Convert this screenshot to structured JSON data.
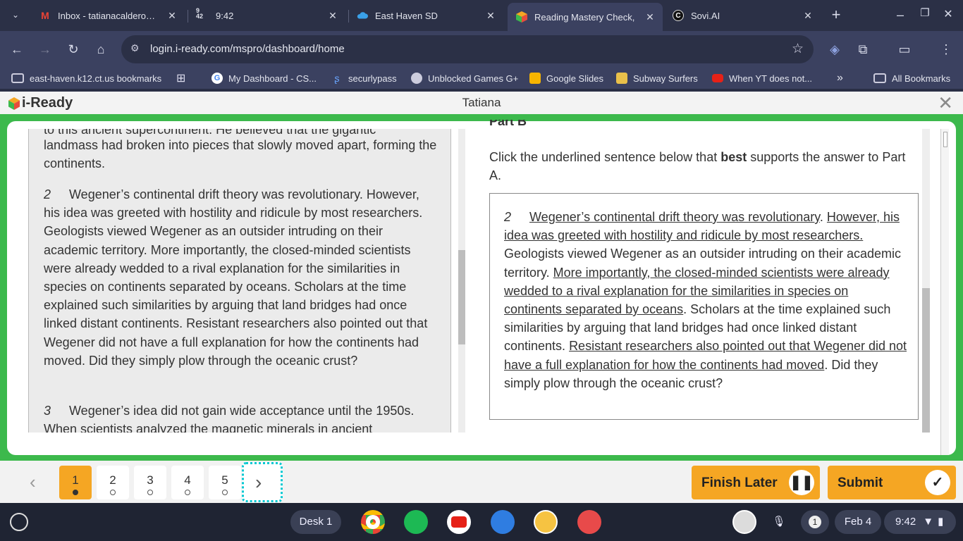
{
  "tabs": [
    {
      "title": "Inbox - tatianacalderon@"
    },
    {
      "title": "9:42",
      "fav_top": "9",
      "fav_bottom": "42"
    },
    {
      "title": "East Haven SD"
    },
    {
      "title": "Reading Mastery Check, "
    },
    {
      "title": "Sovi.AI"
    }
  ],
  "url": "login.i-ready.com/mspro/dashboard/home",
  "bookmarks": {
    "items": [
      "east-haven.k12.ct.us bookmarks",
      "My Dashboard - CS...",
      "securlypass",
      "Unblocked Games G+",
      "Google Slides",
      "Subway Surfers",
      "When YT does not..."
    ],
    "all": "All Bookmarks"
  },
  "header": {
    "logo": "i-Ready",
    "student": "Tatiana"
  },
  "passage": {
    "top_clip": "to this ancient supercontinent. He believed that the gigantic",
    "p1_rest": "landmass had broken into pieces that slowly moved apart, forming the continents.",
    "p2_num": "2",
    "p2": "Wegener’s continental drift theory was revolutionary. However, his idea was greeted with hostility and ridicule by most researchers. Geologists viewed Wegener as an outsider intruding on their academic territory. More importantly, the closed-minded scientists were already wedded to a rival explanation for the similarities in species on continents separated by oceans. Scholars at the time explained such similarities by arguing that land bridges had once linked distant continents. Resistant researchers also pointed out that Wegener did not have a full explanation for how the continents had moved. Did they simply plow through the oceanic crust?",
    "p3_num": "3",
    "p3": "Wegener’s idea did not gain wide acceptance until the 1950s. When scientists analyzed the magnetic minerals in ancient"
  },
  "question": {
    "part_label": "Part B",
    "prompt_pre": "Click the underlined sentence below that ",
    "prompt_bold": "best",
    "prompt_post": " supports the answer to Part A.",
    "para_num": "2",
    "s1": "Wegener’s continental drift theory was revolutionary",
    "s1_end": ". ",
    "s2": "However, his idea was greeted with hostility and ridicule by most researchers.",
    "s3": " Geologists viewed Wegener as an outsider intruding on their academic territory. ",
    "s4": "More importantly, the closed-minded scientists were already wedded to a rival explanation for the similarities in species on continents separated by oceans",
    "s5": ". Scholars at the time explained such similarities by arguing that land bridges had once linked distant continents. ",
    "s6": "Resistant researchers also pointed out that Wegener did not have a full explanation for how the continents had moved",
    "s7": ". Did they simply plow through the oceanic crust?"
  },
  "nav": {
    "pages": [
      "1",
      "2",
      "3",
      "4",
      "5"
    ],
    "current": 1,
    "finish_later": "Finish Later",
    "submit": "Submit"
  },
  "shelf": {
    "desk": "Desk 1",
    "notif": "1",
    "date": "Feb 4",
    "time": "9:42"
  },
  "colors": {
    "accent": "#f5a623",
    "frame": "#3cb94c",
    "focus": "#00c8d2"
  }
}
